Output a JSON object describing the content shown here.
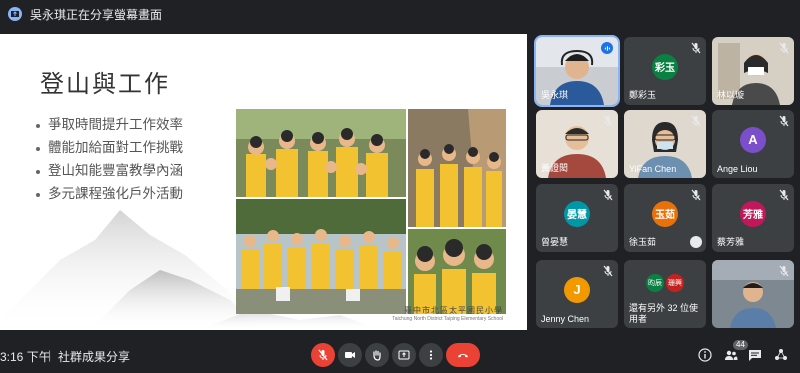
{
  "presenting_banner": {
    "text": "吳永琪正在分享螢幕畫面"
  },
  "slide": {
    "title": "登山與工作",
    "bullets": [
      "爭取時間提升工作效率",
      "體能加給面對工作挑戰",
      "登山知能豐富教學內涵",
      "多元課程強化戶外活動"
    ],
    "school_name_zh": "臺中市北區太平國民小學",
    "school_name_en": "Taichung North District Taiping Elementary School"
  },
  "participants": [
    {
      "name": "吳永琪",
      "type": "video",
      "mic": "speaking"
    },
    {
      "name": "鄭彩玉",
      "initials": "彩玉",
      "color": "#0b8043",
      "mic": "muted"
    },
    {
      "name": "林以璇",
      "type": "video",
      "mic": "muted"
    },
    {
      "name": "黃證閎",
      "type": "video",
      "mic": "muted"
    },
    {
      "name": "YiFan Chen",
      "type": "video",
      "mic": "muted"
    },
    {
      "name": "Ange Liou",
      "initials": "A",
      "color": "#7b4fc9",
      "mic": "muted"
    },
    {
      "name": "曾晏慧",
      "initials": "晏慧",
      "color": "#0097a7",
      "mic": "muted"
    },
    {
      "name": "徐玉茹",
      "initials": "玉茹",
      "color": "#e8710a",
      "mic": "muted"
    },
    {
      "name": "蔡芳雅",
      "initials": "芳雅",
      "color": "#c2185b",
      "mic": "muted"
    },
    {
      "name": "Jenny Chen",
      "initials": "J",
      "color": "#f29900",
      "mic": "muted"
    },
    {
      "name": "還有另外 32 位使用者",
      "mini": [
        "昀辰",
        "珊興"
      ],
      "type": "overflow"
    },
    {
      "name": "",
      "type": "video",
      "mic": "muted"
    }
  ],
  "bottom_bar": {
    "time": "3:16 下午",
    "separator": "|",
    "meeting_name": "社群成果分享",
    "participant_count": "44"
  },
  "icons": [
    "present-icon",
    "mic-off-icon",
    "camera-icon",
    "raise-hand-icon",
    "present-screen-icon",
    "more-icon",
    "hangup-icon",
    "info-icon",
    "people-icon",
    "chat-icon",
    "activities-icon"
  ],
  "colors": {
    "background": "#202124",
    "tile": "#3c4043",
    "accent": "#8ab4f8",
    "danger": "#ea4335"
  }
}
